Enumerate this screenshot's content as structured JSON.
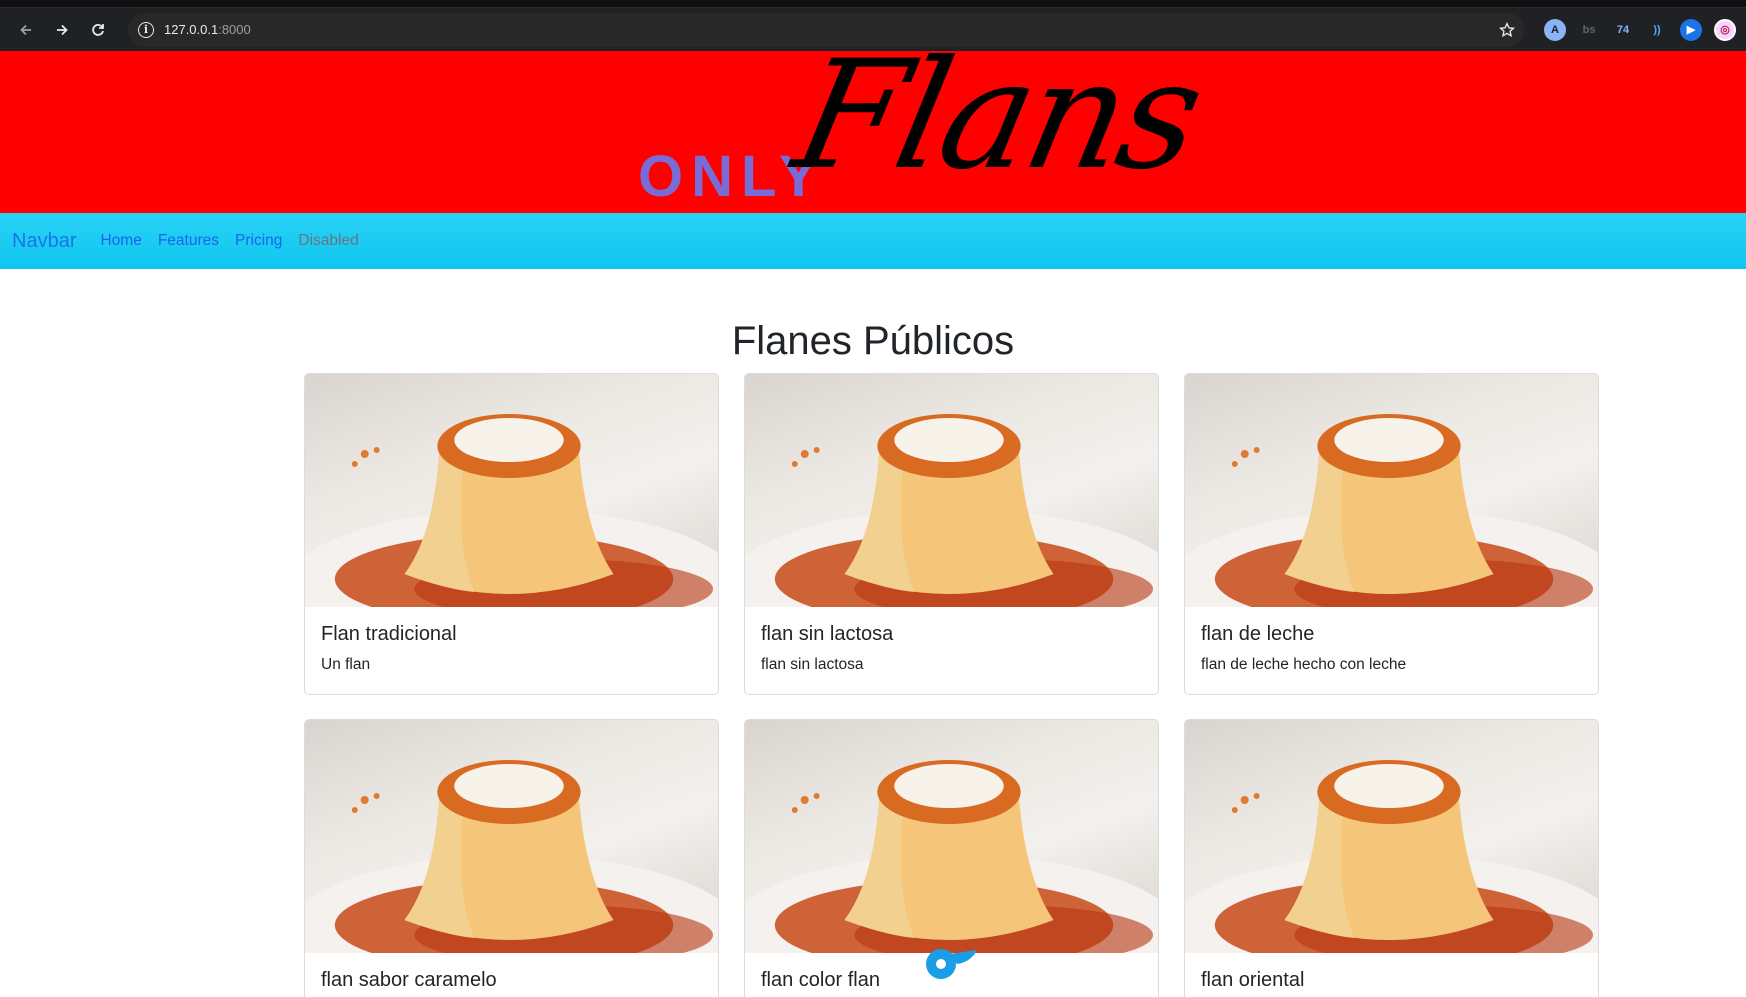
{
  "browser": {
    "url_host": "127.0.0.1",
    "url_port": ":8000",
    "extensions": [
      "A",
      "bs",
      "74",
      "))",
      "▶",
      "◎"
    ]
  },
  "banner": {
    "logo_only": "ONLY",
    "logo_flans": "Flans",
    "background": "#ff0000"
  },
  "navbar": {
    "brand": "Navbar",
    "links": [
      {
        "label": "Home"
      },
      {
        "label": "Features"
      },
      {
        "label": "Pricing"
      },
      {
        "label": "Disabled"
      }
    ]
  },
  "main": {
    "title": "Flanes Públicos",
    "cards": [
      {
        "title": "Flan tradicional",
        "text": "Un flan"
      },
      {
        "title": "flan sin lactosa",
        "text": "flan sin lactosa"
      },
      {
        "title": "flan de leche",
        "text": "flan de leche hecho con leche"
      },
      {
        "title": "flan sabor caramelo",
        "text": ""
      },
      {
        "title": "flan color flan",
        "text": ""
      },
      {
        "title": "flan oriental",
        "text": ""
      }
    ]
  }
}
